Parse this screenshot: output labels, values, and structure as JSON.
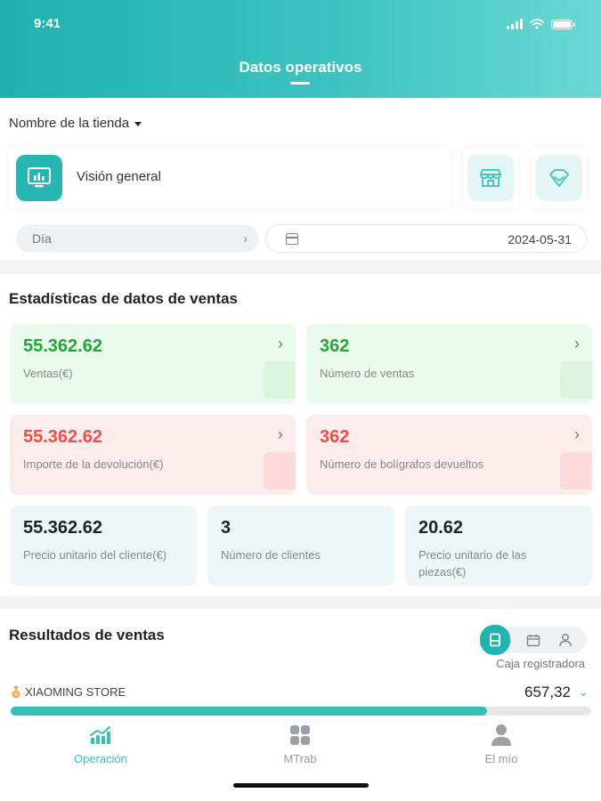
{
  "status": {
    "time": "9:41"
  },
  "nav": {
    "title": "Datos operativos"
  },
  "store": {
    "name": "Nombre de la tienda"
  },
  "overview": {
    "label": "Visión general"
  },
  "filter": {
    "period": "Día",
    "date": "2024-05-31"
  },
  "sales_stats": {
    "title": "Estadísticas de datos de ventas",
    "cards": [
      {
        "value": "55.362.62",
        "label": "Ventas(€)"
      },
      {
        "value": "362",
        "label": "Número de ventas"
      },
      {
        "value": "55.362.62",
        "label": "Importe de la devolución(€)"
      },
      {
        "value": "362",
        "label": "Número de bolígrafos devueltos"
      },
      {
        "value": "55.362.62",
        "label": "Precio unitario del cliente(€)"
      },
      {
        "value": "3",
        "label": "Número de clientes"
      },
      {
        "value": "20.62",
        "label": "Precio unitario de las piezas(€)"
      }
    ]
  },
  "results": {
    "title": "Resultados de ventas",
    "toggle_label": "Caja registradora",
    "store_name": "XIAOMING STORE",
    "store_value": "657,32",
    "progress": 0.82
  },
  "tabs": [
    {
      "label": "Operación"
    },
    {
      "label": "MTrab"
    },
    {
      "label": "El mío"
    }
  ],
  "colors": {
    "accent": "#22b2b0",
    "green": "#24a636",
    "red": "#e8524a"
  }
}
